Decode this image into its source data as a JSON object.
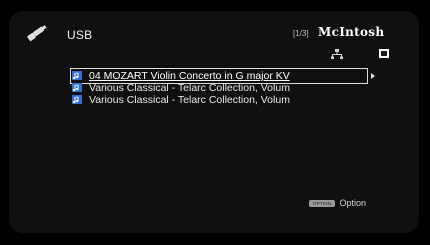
{
  "header": {
    "source_title": "USB",
    "page_indicator": "[1/3]",
    "brand_logo": "McIntosh",
    "usb_icon": "usb-plug-icon"
  },
  "status": {
    "network_icon": "network-icon",
    "stop_icon": "stop-icon"
  },
  "file_list": {
    "items": [
      {
        "label": "04 MOZART Violin Concerto in G major KV",
        "icon": "music-file-icon",
        "selected": true
      },
      {
        "label": "Various Classical - Telarc Collection, Volum",
        "icon": "music-file-icon",
        "selected": false
      },
      {
        "label": "Various Classical - Telarc Collection, Volum",
        "icon": "music-file-icon",
        "selected": false
      }
    ]
  },
  "footer": {
    "option_key_label": "OPTION",
    "option_label": "Option"
  },
  "colors": {
    "background": "#101010",
    "text": "#e8e8e8",
    "icon_blue": "#2e6fd6",
    "selection_outline": "#dcdcdc"
  }
}
